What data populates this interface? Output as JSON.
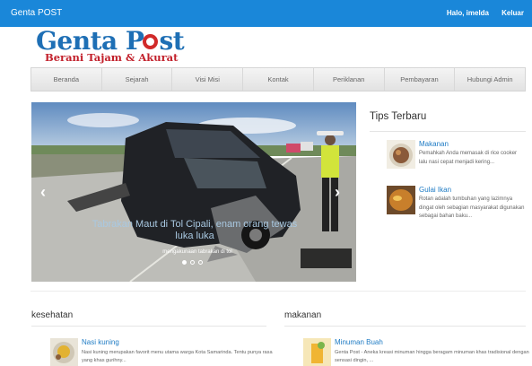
{
  "header": {
    "brand": "Genta POST",
    "user_greeting": "Halo, imelda",
    "logout_label": "Keluar"
  },
  "logo": {
    "name": "Genta P",
    "name_end": "st",
    "tagline": "Berani Tajam & Akurat"
  },
  "nav": {
    "items": [
      "Beranda",
      "Sejarah",
      "Visi Misi",
      "Kontak",
      "Periklanan",
      "Pembayaran",
      "Hubungi Admin"
    ]
  },
  "carousel": {
    "caption": "Tabrakan Maut di Tol Cipali, enam orang tewas luka luka",
    "subcaption": "mengakunaan tabrakan di tol",
    "slide_count": 3,
    "active_slide": 1
  },
  "tips": {
    "title": "Tips Terbaru",
    "items": [
      {
        "title": "Makanan",
        "text": "Pemahkah Anda memasak di rice cooker lalu nasi cepat menjadi kering..."
      },
      {
        "title": "Gulai Ikan",
        "text": "Rotan adalah tumbuhan yang lazimnya dingat oleh sebagian masyarakat digunakan sebagai bahan baku..."
      }
    ]
  },
  "sections": [
    {
      "title": "kesehatan",
      "item": {
        "title": "Nasi kuning",
        "text": "Nasi kuning merupakan favorit menu utama warga Kota Samarinda. Tentu punya rasa yang khas gurihny..."
      }
    },
    {
      "title": "makanan",
      "item": {
        "title": "Minuman Buah",
        "text": "Genta Post - Aneka kreasi minuman hingga beragam minuman khas tradisional dengan sensasi dingin, ..."
      }
    }
  ],
  "colors": {
    "topbar": "#1a87d9",
    "link": "#1e7bc4",
    "logo_blue": "#1e6fb5",
    "logo_red": "#c2202b"
  }
}
